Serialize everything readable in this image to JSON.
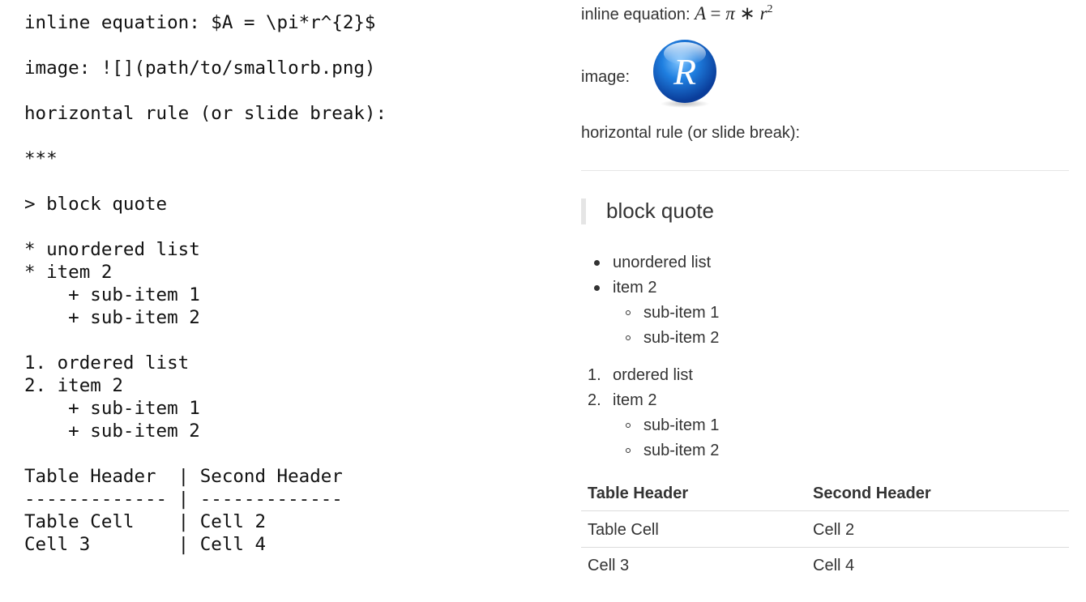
{
  "source": {
    "lines": [
      "inline equation: $A = \\pi*r^{2}$",
      "",
      "image: ![](path/to/smallorb.png)",
      "",
      "horizontal rule (or slide break):",
      "",
      "***",
      "",
      "> block quote",
      "",
      "* unordered list",
      "* item 2",
      "    + sub-item 1",
      "    + sub-item 2",
      "",
      "1. ordered list",
      "2. item 2",
      "    + sub-item 1",
      "    + sub-item 2",
      "",
      "Table Header  | Second Header",
      "------------- | -------------",
      "Table Cell    | Cell 2",
      "Cell 3        | Cell 4"
    ]
  },
  "preview": {
    "equation_label": "inline equation:",
    "equation": {
      "A": "A",
      "equals": "=",
      "pi": "π",
      "star": "∗",
      "r": "r",
      "exp": "2"
    },
    "image_label": "image:",
    "logo_letter": "R",
    "hr_label": "horizontal rule (or slide break):",
    "blockquote": "block quote",
    "unordered": {
      "items": [
        "unordered list",
        "item 2"
      ],
      "subitems": [
        "sub-item 1",
        "sub-item 2"
      ]
    },
    "ordered": {
      "markers": [
        "1.",
        "2."
      ],
      "items": [
        "ordered list",
        "item 2"
      ],
      "subitems": [
        "sub-item 1",
        "sub-item 2"
      ]
    },
    "table": {
      "headers": [
        "Table Header",
        "Second Header"
      ],
      "rows": [
        [
          "Table Cell",
          "Cell 2"
        ],
        [
          "Cell 3",
          "Cell 4"
        ]
      ]
    }
  }
}
